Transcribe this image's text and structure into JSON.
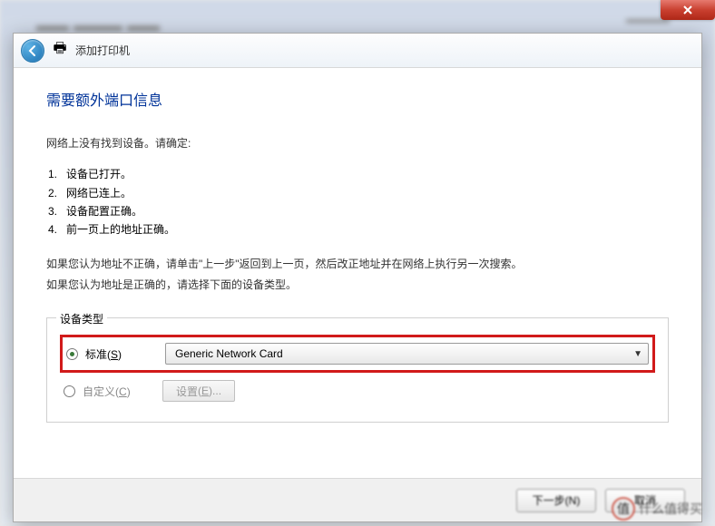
{
  "titlebar": {
    "close_tooltip": "关闭"
  },
  "header": {
    "title": "添加打印机"
  },
  "page": {
    "heading": "需要额外端口信息",
    "intro": "网络上没有找到设备。请确定:",
    "checklist": [
      "设备已打开。",
      "网络已连上。",
      "设备配置正确。",
      "前一页上的地址正确。"
    ],
    "help_line1": "如果您认为地址不正确，请单击\"上一步\"返回到上一页，然后改正地址并在网络上执行另一次搜索。",
    "help_line2": "如果您认为地址是正确的，请选择下面的设备类型。"
  },
  "fieldset": {
    "legend": "设备类型",
    "standard": {
      "label": "标准",
      "hotkey": "S",
      "checked": true,
      "dropdown_value": "Generic Network Card"
    },
    "custom": {
      "label": "自定义",
      "hotkey": "C",
      "checked": false,
      "settings_button": "设置",
      "settings_hotkey": "E"
    }
  },
  "footer": {
    "next": "下一步(N)",
    "cancel": "取消"
  },
  "watermark": {
    "text": "什么值得买"
  }
}
